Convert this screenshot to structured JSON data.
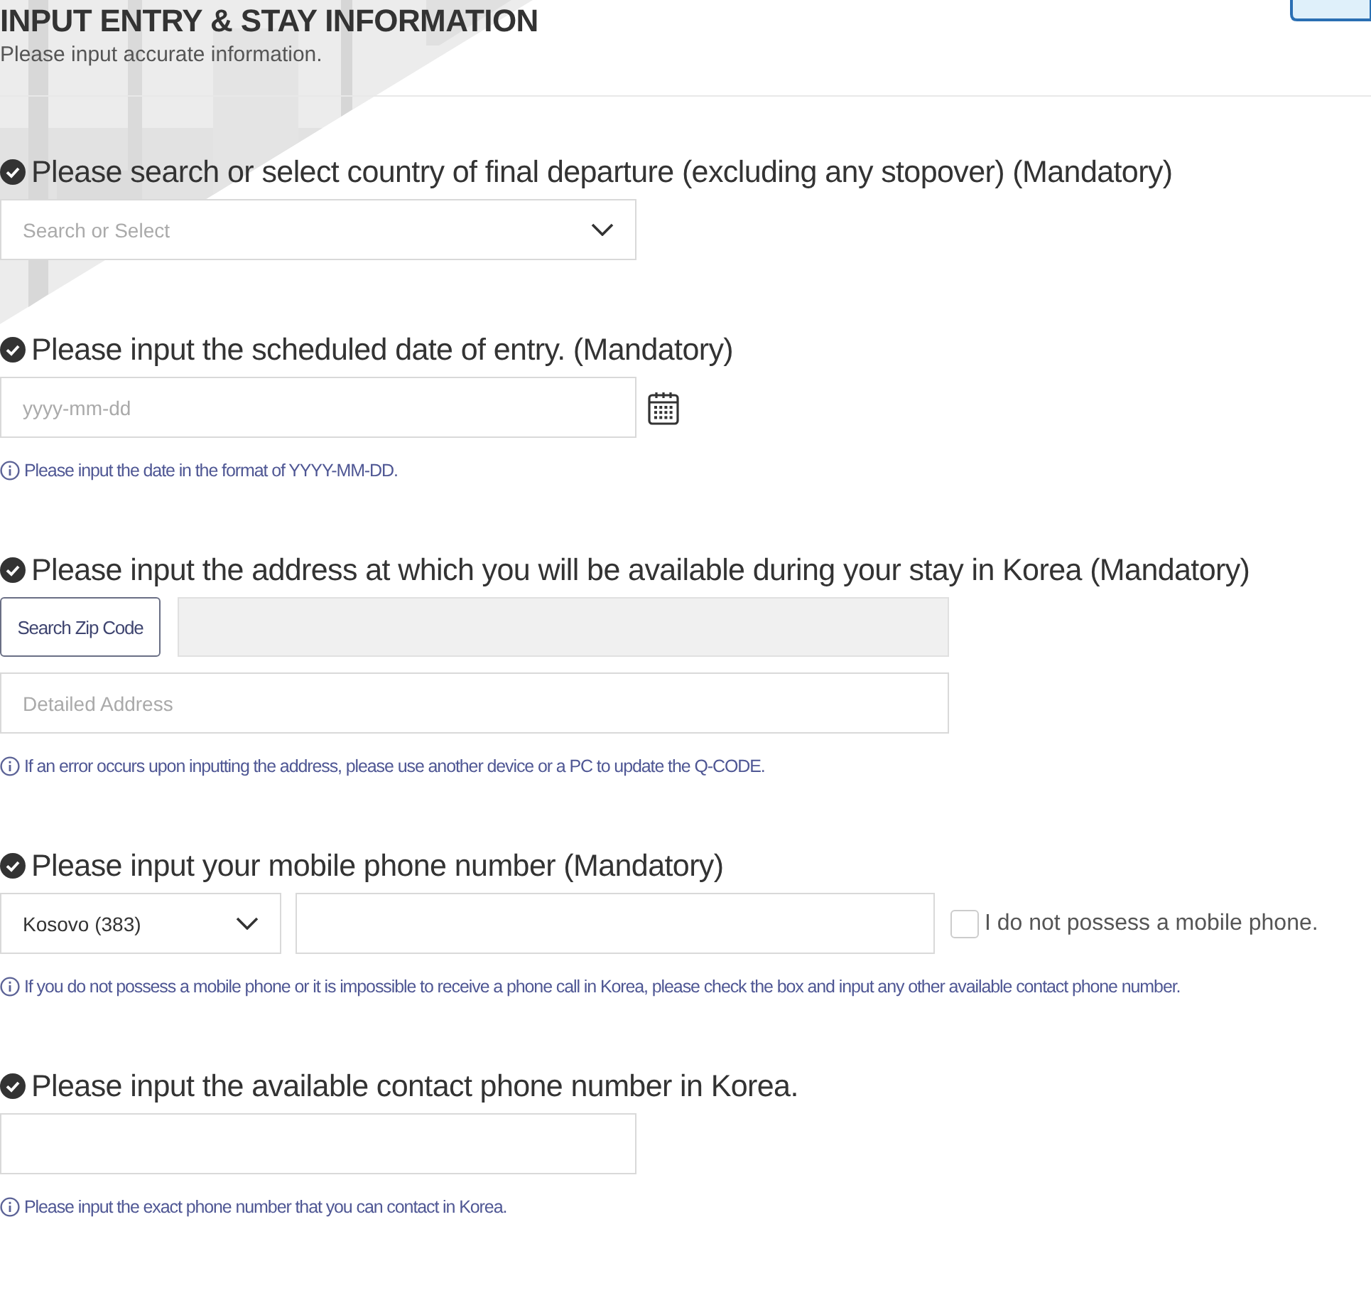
{
  "header": {
    "title": "INPUT ENTRY & STAY INFORMATION",
    "subtitle": "Please input accurate information."
  },
  "sections": [
    {
      "kind": "select",
      "label": "Please search or select country of final departure (excluding any stopover) (Mandatory)",
      "placeholder": "Search or Select"
    },
    {
      "kind": "date",
      "label": "Please input the scheduled date of entry. (Mandatory)",
      "placeholder": "yyyy-mm-dd",
      "hint": "Please input the date in the format of YYYY-MM-DD."
    },
    {
      "kind": "address",
      "label": "Please input the address at which you will be available during your stay in Korea (Mandatory)",
      "button": "Search Zip Code",
      "placeholder": "Detailed Address",
      "hint": "If an error occurs upon inputting the address, please use another device or a PC to update the Q-CODE."
    },
    {
      "kind": "phone",
      "label": "Please input your mobile phone number (Mandatory)",
      "country": "Kosovo (383)",
      "checkbox": {
        "label": "I do not possess a mobile phone.",
        "checked": false
      },
      "hint": "If you do not possess a mobile phone or it is impossible to receive a phone call in Korea, please check the box and input any other available contact phone number."
    },
    {
      "kind": "text",
      "label": "Please input the available contact phone number in Korea.",
      "hint": "Please input the exact phone number that you can contact in Korea."
    }
  ]
}
